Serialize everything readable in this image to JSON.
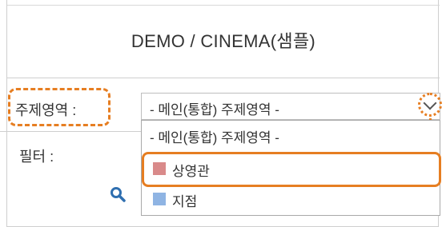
{
  "header": {
    "title": "DEMO / CINEMA(샘플)"
  },
  "subject_area": {
    "label": "주제영역 :",
    "selected": "- 메인(통합) 주제영역 -",
    "options": [
      {
        "label": "- 메인(통합) 주제영역 -",
        "color": ""
      },
      {
        "label": "상영관",
        "color": "#d98a8a"
      },
      {
        "label": "지점",
        "color": "#8fb4e3"
      }
    ]
  },
  "filter": {
    "label": "필터 :"
  },
  "icons": {
    "search": "search-icon",
    "dropdown": "chevron-down-icon"
  },
  "colors": {
    "highlight": "#e67e22",
    "search_icon": "#2f6fb0"
  }
}
